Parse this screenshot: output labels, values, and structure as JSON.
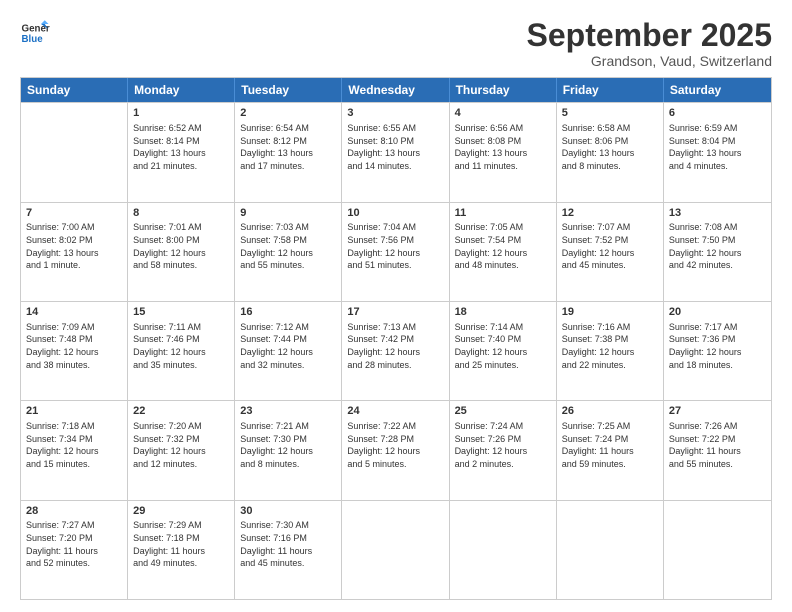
{
  "logo": {
    "line1": "General",
    "line2": "Blue"
  },
  "title": "September 2025",
  "subtitle": "Grandson, Vaud, Switzerland",
  "header_days": [
    "Sunday",
    "Monday",
    "Tuesday",
    "Wednesday",
    "Thursday",
    "Friday",
    "Saturday"
  ],
  "weeks": [
    [
      {
        "day": "",
        "info": ""
      },
      {
        "day": "1",
        "info": "Sunrise: 6:52 AM\nSunset: 8:14 PM\nDaylight: 13 hours\nand 21 minutes."
      },
      {
        "day": "2",
        "info": "Sunrise: 6:54 AM\nSunset: 8:12 PM\nDaylight: 13 hours\nand 17 minutes."
      },
      {
        "day": "3",
        "info": "Sunrise: 6:55 AM\nSunset: 8:10 PM\nDaylight: 13 hours\nand 14 minutes."
      },
      {
        "day": "4",
        "info": "Sunrise: 6:56 AM\nSunset: 8:08 PM\nDaylight: 13 hours\nand 11 minutes."
      },
      {
        "day": "5",
        "info": "Sunrise: 6:58 AM\nSunset: 8:06 PM\nDaylight: 13 hours\nand 8 minutes."
      },
      {
        "day": "6",
        "info": "Sunrise: 6:59 AM\nSunset: 8:04 PM\nDaylight: 13 hours\nand 4 minutes."
      }
    ],
    [
      {
        "day": "7",
        "info": "Sunrise: 7:00 AM\nSunset: 8:02 PM\nDaylight: 13 hours\nand 1 minute."
      },
      {
        "day": "8",
        "info": "Sunrise: 7:01 AM\nSunset: 8:00 PM\nDaylight: 12 hours\nand 58 minutes."
      },
      {
        "day": "9",
        "info": "Sunrise: 7:03 AM\nSunset: 7:58 PM\nDaylight: 12 hours\nand 55 minutes."
      },
      {
        "day": "10",
        "info": "Sunrise: 7:04 AM\nSunset: 7:56 PM\nDaylight: 12 hours\nand 51 minutes."
      },
      {
        "day": "11",
        "info": "Sunrise: 7:05 AM\nSunset: 7:54 PM\nDaylight: 12 hours\nand 48 minutes."
      },
      {
        "day": "12",
        "info": "Sunrise: 7:07 AM\nSunset: 7:52 PM\nDaylight: 12 hours\nand 45 minutes."
      },
      {
        "day": "13",
        "info": "Sunrise: 7:08 AM\nSunset: 7:50 PM\nDaylight: 12 hours\nand 42 minutes."
      }
    ],
    [
      {
        "day": "14",
        "info": "Sunrise: 7:09 AM\nSunset: 7:48 PM\nDaylight: 12 hours\nand 38 minutes."
      },
      {
        "day": "15",
        "info": "Sunrise: 7:11 AM\nSunset: 7:46 PM\nDaylight: 12 hours\nand 35 minutes."
      },
      {
        "day": "16",
        "info": "Sunrise: 7:12 AM\nSunset: 7:44 PM\nDaylight: 12 hours\nand 32 minutes."
      },
      {
        "day": "17",
        "info": "Sunrise: 7:13 AM\nSunset: 7:42 PM\nDaylight: 12 hours\nand 28 minutes."
      },
      {
        "day": "18",
        "info": "Sunrise: 7:14 AM\nSunset: 7:40 PM\nDaylight: 12 hours\nand 25 minutes."
      },
      {
        "day": "19",
        "info": "Sunrise: 7:16 AM\nSunset: 7:38 PM\nDaylight: 12 hours\nand 22 minutes."
      },
      {
        "day": "20",
        "info": "Sunrise: 7:17 AM\nSunset: 7:36 PM\nDaylight: 12 hours\nand 18 minutes."
      }
    ],
    [
      {
        "day": "21",
        "info": "Sunrise: 7:18 AM\nSunset: 7:34 PM\nDaylight: 12 hours\nand 15 minutes."
      },
      {
        "day": "22",
        "info": "Sunrise: 7:20 AM\nSunset: 7:32 PM\nDaylight: 12 hours\nand 12 minutes."
      },
      {
        "day": "23",
        "info": "Sunrise: 7:21 AM\nSunset: 7:30 PM\nDaylight: 12 hours\nand 8 minutes."
      },
      {
        "day": "24",
        "info": "Sunrise: 7:22 AM\nSunset: 7:28 PM\nDaylight: 12 hours\nand 5 minutes."
      },
      {
        "day": "25",
        "info": "Sunrise: 7:24 AM\nSunset: 7:26 PM\nDaylight: 12 hours\nand 2 minutes."
      },
      {
        "day": "26",
        "info": "Sunrise: 7:25 AM\nSunset: 7:24 PM\nDaylight: 11 hours\nand 59 minutes."
      },
      {
        "day": "27",
        "info": "Sunrise: 7:26 AM\nSunset: 7:22 PM\nDaylight: 11 hours\nand 55 minutes."
      }
    ],
    [
      {
        "day": "28",
        "info": "Sunrise: 7:27 AM\nSunset: 7:20 PM\nDaylight: 11 hours\nand 52 minutes."
      },
      {
        "day": "29",
        "info": "Sunrise: 7:29 AM\nSunset: 7:18 PM\nDaylight: 11 hours\nand 49 minutes."
      },
      {
        "day": "30",
        "info": "Sunrise: 7:30 AM\nSunset: 7:16 PM\nDaylight: 11 hours\nand 45 minutes."
      },
      {
        "day": "",
        "info": ""
      },
      {
        "day": "",
        "info": ""
      },
      {
        "day": "",
        "info": ""
      },
      {
        "day": "",
        "info": ""
      }
    ]
  ]
}
